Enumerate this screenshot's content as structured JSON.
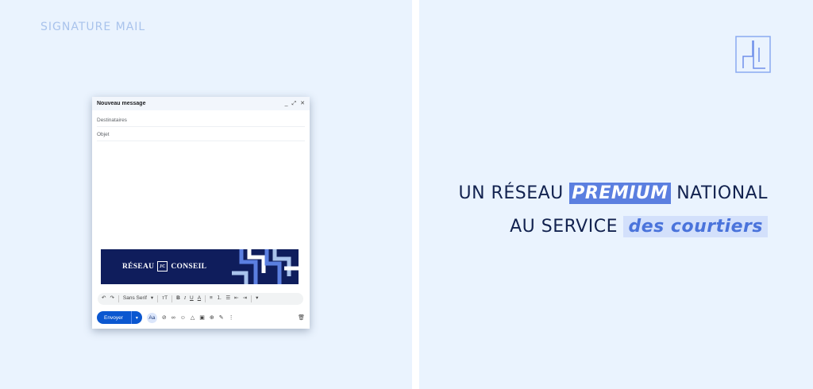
{
  "left": {
    "section_label": "SIGNATURE MAIL"
  },
  "compose": {
    "title": "Nouveau message",
    "header_icons": [
      "minimize-icon",
      "expand-icon",
      "close-icon"
    ],
    "to_placeholder": "Destinataires",
    "subject_placeholder": "Objet",
    "banner": {
      "text_left": "RÉSEAU",
      "logo_text": "JC",
      "text_right": "CONSEIL"
    },
    "format_bar": {
      "font": "Sans Serif",
      "size_symbol": "тT",
      "bold": "B",
      "italic": "I",
      "underline": "U",
      "color": "A"
    },
    "send_label": "Envoyer",
    "aa_label": "Aa"
  },
  "right": {
    "line1_before": "UN RÉSEAU",
    "line1_highlight": "PREMIUM",
    "line1_after": "NATIONAL",
    "line2_before": "AU SERVICE",
    "line2_highlight": "des courtiers"
  },
  "colors": {
    "panel_bg": "#eaf3fe",
    "navy": "#12224f",
    "premium_bg": "#5b7fe0",
    "courtiers_bg": "#d3e0fb",
    "send_blue": "#0b57d0",
    "banner_navy": "#0f1d5c"
  }
}
